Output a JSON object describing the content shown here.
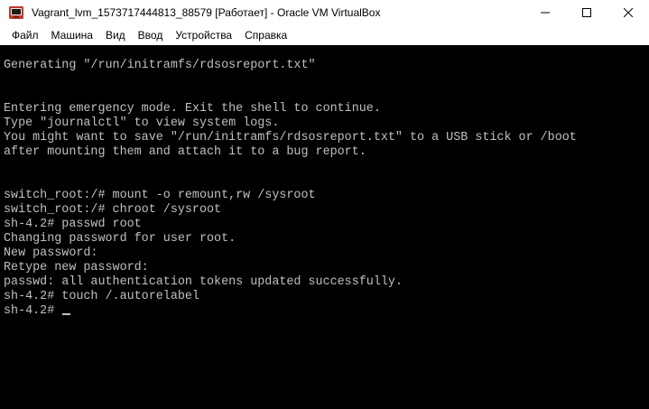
{
  "window": {
    "title": "Vagrant_lvm_1573717444813_88579 [Работает] - Oracle VM VirtualBox",
    "app_icon": "virtualbox-icon",
    "controls": {
      "minimize_icon": "minimize-icon",
      "maximize_icon": "maximize-icon",
      "close_icon": "close-icon"
    }
  },
  "menubar": {
    "items": [
      {
        "label": "Файл"
      },
      {
        "label": "Машина"
      },
      {
        "label": "Вид"
      },
      {
        "label": "Ввод"
      },
      {
        "label": "Устройства"
      },
      {
        "label": "Справка"
      }
    ]
  },
  "console": {
    "background": "#000000",
    "foreground": "#c0c0c0",
    "lines": [
      "Generating \"/run/initramfs/rdsosreport.txt\"",
      "",
      "",
      "Entering emergency mode. Exit the shell to continue.",
      "Type \"journalctl\" to view system logs.",
      "You might want to save \"/run/initramfs/rdsosreport.txt\" to a USB stick or /boot",
      "after mounting them and attach it to a bug report.",
      "",
      "",
      "switch_root:/# mount -o remount,rw /sysroot",
      "switch_root:/# chroot /sysroot",
      "sh-4.2# passwd root",
      "Changing password for user root.",
      "New password:",
      "Retype new password:",
      "passwd: all authentication tokens updated successfully.",
      "sh-4.2# touch /.autorelabel",
      "sh-4.2# "
    ]
  }
}
